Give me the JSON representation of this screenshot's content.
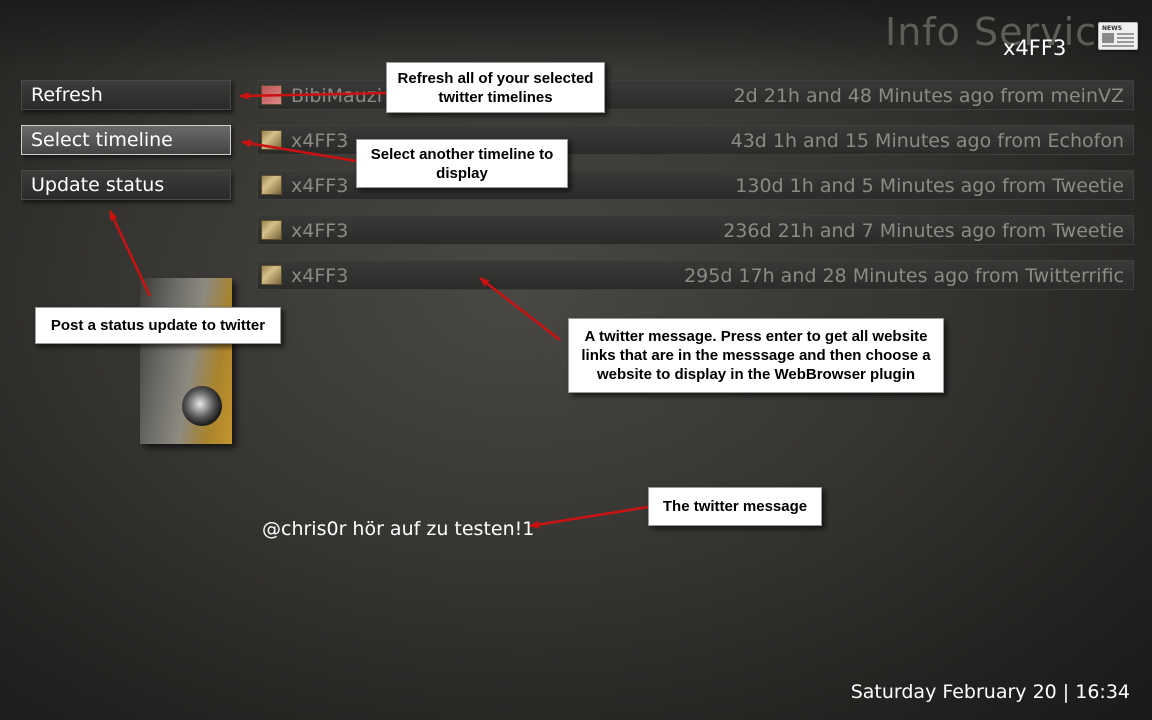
{
  "header": {
    "title": "Info Service",
    "user": "x4FF3",
    "icon": "newspaper-icon",
    "icon_label": "NEWS"
  },
  "menu": {
    "items": [
      {
        "label": "Refresh"
      },
      {
        "label": "Select timeline"
      },
      {
        "label": "Update status"
      }
    ]
  },
  "timeline": {
    "rows": [
      {
        "user": "BibiMauzi",
        "meta": "2d 21h and 48 Minutes ago from meinVZ"
      },
      {
        "user": "x4FF3",
        "meta": "43d 1h and 15 Minutes ago from Echofon"
      },
      {
        "user": "x4FF3",
        "meta": "130d 1h and 5 Minutes ago from Tweetie"
      },
      {
        "user": "x4FF3",
        "meta": "236d 21h and 7 Minutes ago from Tweetie"
      },
      {
        "user": "x4FF3",
        "meta": "295d 17h and 28 Minutes ago from Twitterrific"
      }
    ]
  },
  "message": "@chris0r hör auf zu testen!1",
  "footer": {
    "datetime": "Saturday February 20  |  16:34"
  },
  "callouts": {
    "refresh": "Refresh all of your selected twitter timelines",
    "select_timeline": "Select another timeline to display",
    "update_status": "Post a status update to twitter",
    "twitter_message_row": "A twitter message. Press enter to get all website links that are in the messsage and then choose a website to display in the WebBrowser plugin",
    "message_text": "The twitter message"
  },
  "colors": {
    "callout_arrow": "#cc1111",
    "background": "#363532"
  }
}
